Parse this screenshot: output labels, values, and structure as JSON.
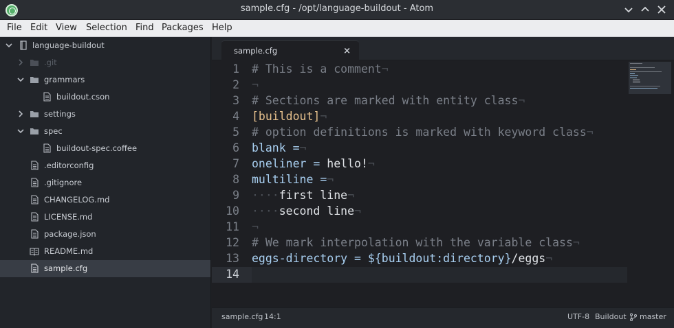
{
  "window": {
    "title": "sample.cfg - /opt/language-buildout - Atom"
  },
  "menubar": {
    "items": [
      "File",
      "Edit",
      "View",
      "Selection",
      "Find",
      "Packages",
      "Help"
    ]
  },
  "tree": {
    "root": "language-buildout",
    "items": [
      {
        "label": ".git",
        "type": "folder",
        "state": "collapsed",
        "dim": true
      },
      {
        "label": "grammars",
        "type": "folder",
        "state": "expanded"
      },
      {
        "label": "buildout.cson",
        "type": "file"
      },
      {
        "label": "settings",
        "type": "folder",
        "state": "collapsed"
      },
      {
        "label": "spec",
        "type": "folder",
        "state": "expanded"
      },
      {
        "label": "buildout-spec.coffee",
        "type": "file"
      },
      {
        "label": ".editorconfig",
        "type": "file"
      },
      {
        "label": ".gitignore",
        "type": "file"
      },
      {
        "label": "CHANGELOG.md",
        "type": "file"
      },
      {
        "label": "LICENSE.md",
        "type": "file"
      },
      {
        "label": "package.json",
        "type": "file"
      },
      {
        "label": "README.md",
        "type": "file-book"
      },
      {
        "label": "sample.cfg",
        "type": "file",
        "selected": true
      }
    ]
  },
  "tab": {
    "label": "sample.cfg",
    "close": "×"
  },
  "editor": {
    "invisible_eol": "¬",
    "indent_marker": "····",
    "line_numbers": [
      "1",
      "2",
      "3",
      "4",
      "5",
      "6",
      "7",
      "8",
      "9",
      "10",
      "11",
      "12",
      "13",
      "14"
    ],
    "current_line": 14,
    "lines": {
      "l1": "# This is a comment",
      "l3": "# Sections are marked with entity class",
      "l4": "[buildout]",
      "l5": "# option definitions is marked with keyword class",
      "l6_key": "blank =",
      "l7_key": "oneliner =",
      "l7_val": " hello!",
      "l8_key": "multiline =",
      "l9_val": "first line",
      "l10_val": "second line",
      "l12": "# We mark interpolation with the variable class",
      "l13_key": "eggs-directory =",
      "l13_var": "${buildout:directory}",
      "l13_val": "/eggs"
    }
  },
  "statusbar": {
    "file": "sample.cfg",
    "cursor": "14:1",
    "encoding": "UTF-8",
    "grammar": "Buildout",
    "branch": "master"
  },
  "colors": {
    "comment": "#7a7f88",
    "section": "#e8c28e",
    "keyword": "#a9d0f2",
    "background": "#1e1f23"
  }
}
